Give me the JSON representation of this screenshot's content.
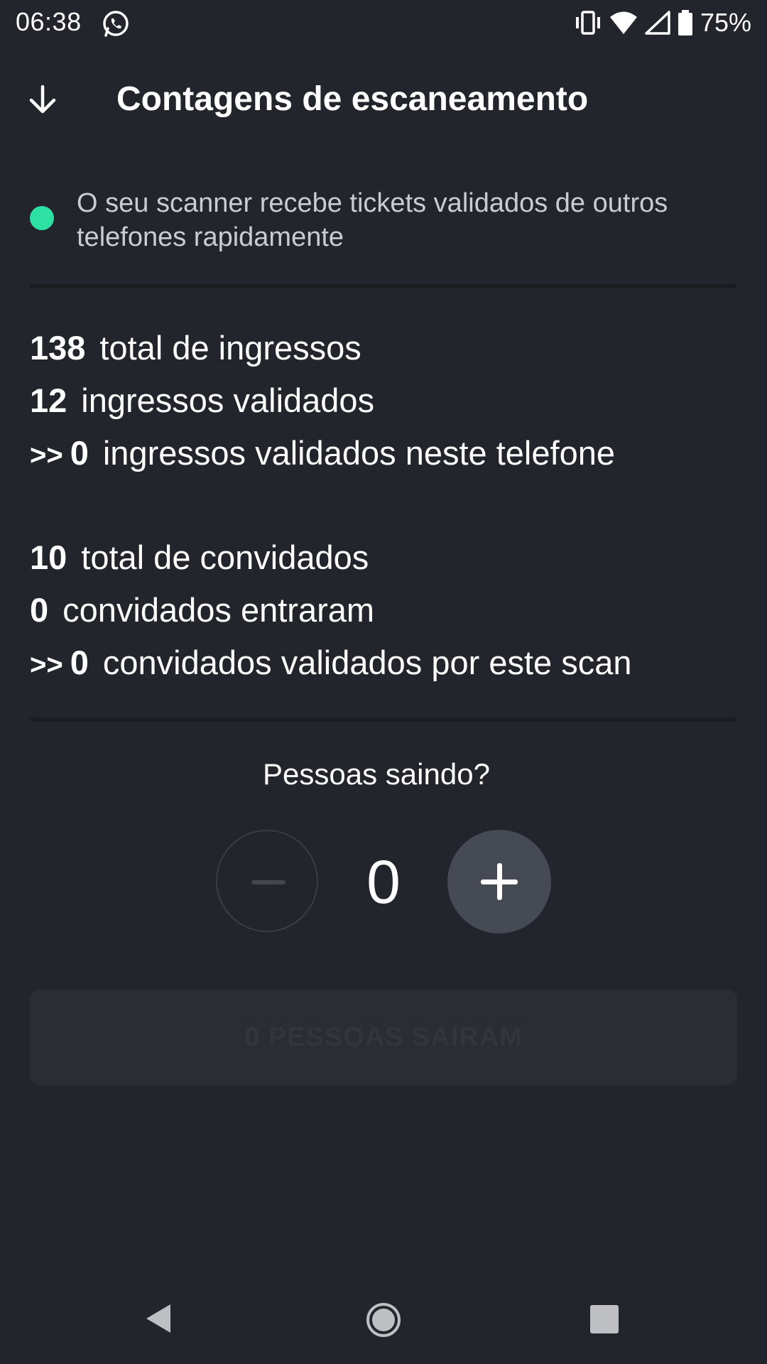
{
  "status_bar": {
    "time": "06:38",
    "battery_percent": "75%",
    "icons": [
      "whatsapp-icon",
      "vibrate-icon",
      "wifi-icon",
      "signal-icon",
      "battery-icon"
    ]
  },
  "app_bar": {
    "title": "Contagens de escaneamento",
    "back_icon": "arrow-down-icon"
  },
  "sync": {
    "status_color": "#2fe0a4",
    "message": "O seu scanner recebe tickets validados de outros telefones rapidamente"
  },
  "tickets": [
    {
      "prefix": "",
      "value": "138",
      "label": "total de ingressos"
    },
    {
      "prefix": "",
      "value": "12",
      "label": "ingressos validados"
    },
    {
      "prefix": ">>",
      "value": "0",
      "label": "ingressos validados neste telefone"
    }
  ],
  "guests": [
    {
      "prefix": "",
      "value": "10",
      "label": "total de convidados"
    },
    {
      "prefix": "",
      "value": "0",
      "label": "convidados entraram"
    },
    {
      "prefix": ">>",
      "value": "0",
      "label": "convidados validados por este scan"
    }
  ],
  "leaving": {
    "label": "Pessoas saindo?",
    "count": "0",
    "confirm_label": "0 PESSOAS SAIRAM"
  },
  "colors": {
    "background": "#22252b",
    "accent": "#2fe0a4"
  }
}
